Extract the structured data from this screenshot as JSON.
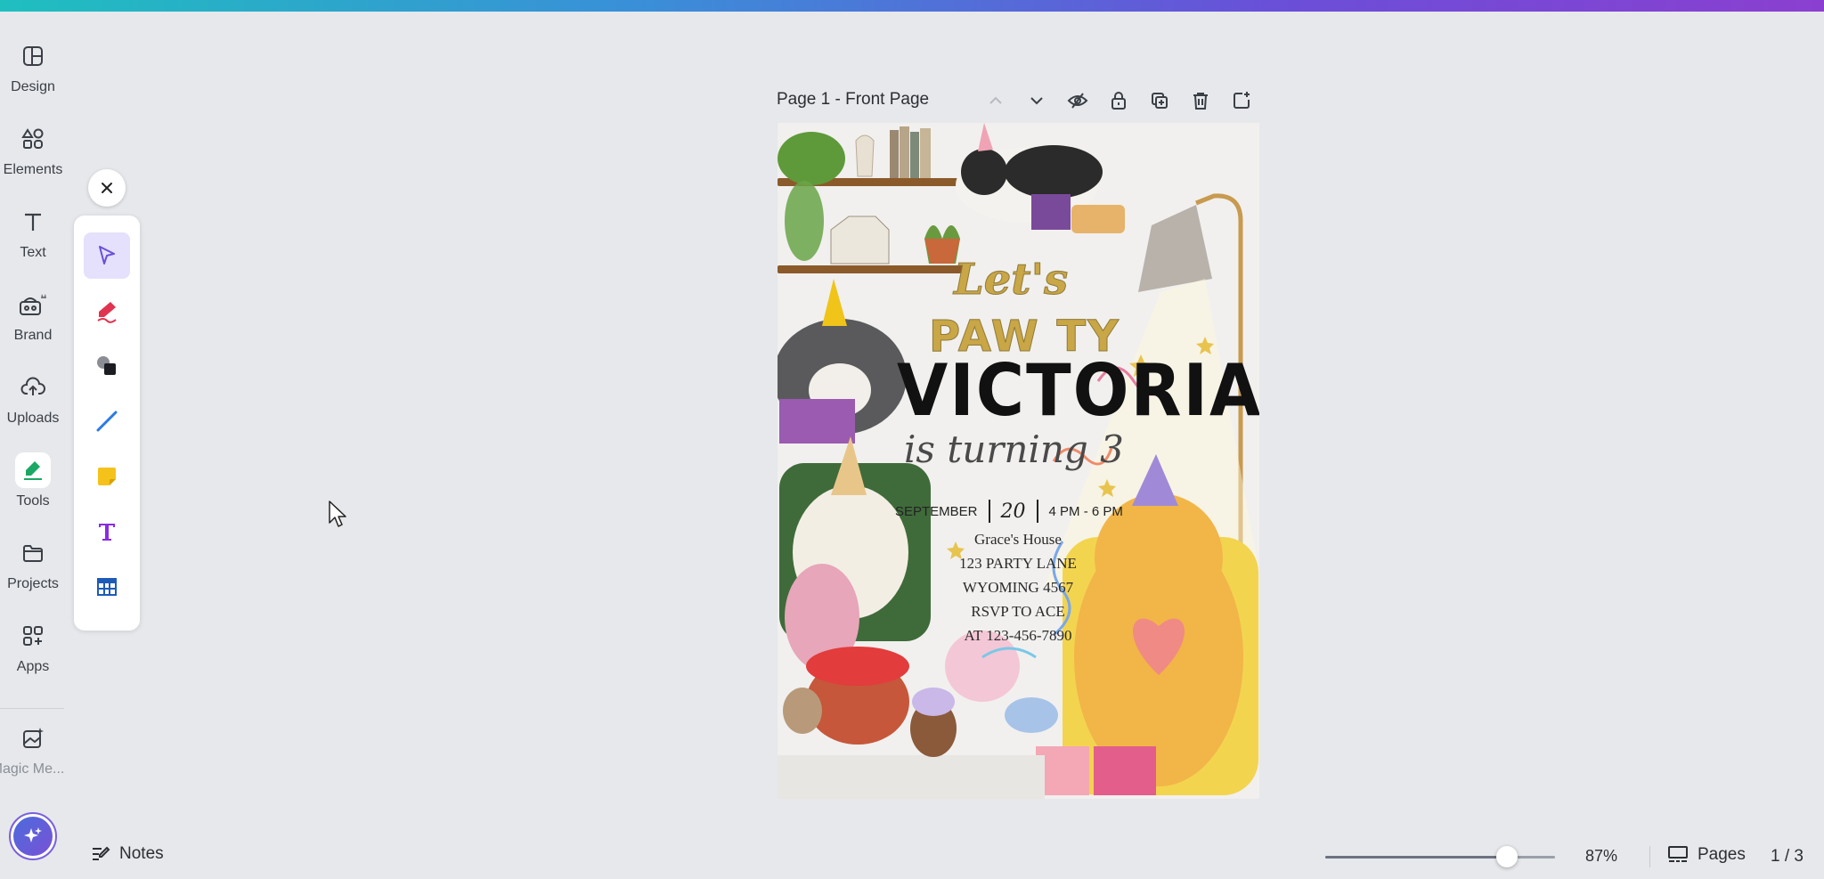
{
  "rail": {
    "items": [
      {
        "label": "Design",
        "icon": "layout-icon"
      },
      {
        "label": "Elements",
        "icon": "shapes-icon"
      },
      {
        "label": "Text",
        "icon": "text-icon"
      },
      {
        "label": "Brand",
        "icon": "brand-icon"
      },
      {
        "label": "Uploads",
        "icon": "cloud-upload-icon"
      },
      {
        "label": "Tools",
        "icon": "pen-tool-icon"
      },
      {
        "label": "Projects",
        "icon": "folder-icon"
      },
      {
        "label": "Apps",
        "icon": "apps-grid-icon"
      },
      {
        "label": "Magic Me...",
        "icon": "magic-media-icon"
      }
    ]
  },
  "tools": [
    "select-tool",
    "pen-tool",
    "shapes-tool",
    "line-tool",
    "sticky-note-tool",
    "text-tool",
    "table-tool"
  ],
  "page": {
    "title": "Page 1 - Front Page"
  },
  "invite": {
    "lets": "Let's",
    "pawty": "PAW TY",
    "name": "VICTORIA",
    "turning": "is turning 3",
    "month": "SEPTEMBER",
    "day": "20",
    "time": "4 PM - 6 PM",
    "address": [
      "Grace's House",
      "123 PARTY LANE",
      "WYOMING 4567",
      "RSVP TO ACE",
      "AT 123-456-7890"
    ]
  },
  "bottom": {
    "notes": "Notes",
    "zoom_percent": "87%",
    "zoom_value": 0.87,
    "pages_label": "Pages",
    "page_count": "1 / 3"
  },
  "colors": {
    "accent": "#7b5fdc",
    "selected_tool_bg": "#e5e0fb",
    "gold_text": "#c9a646"
  }
}
